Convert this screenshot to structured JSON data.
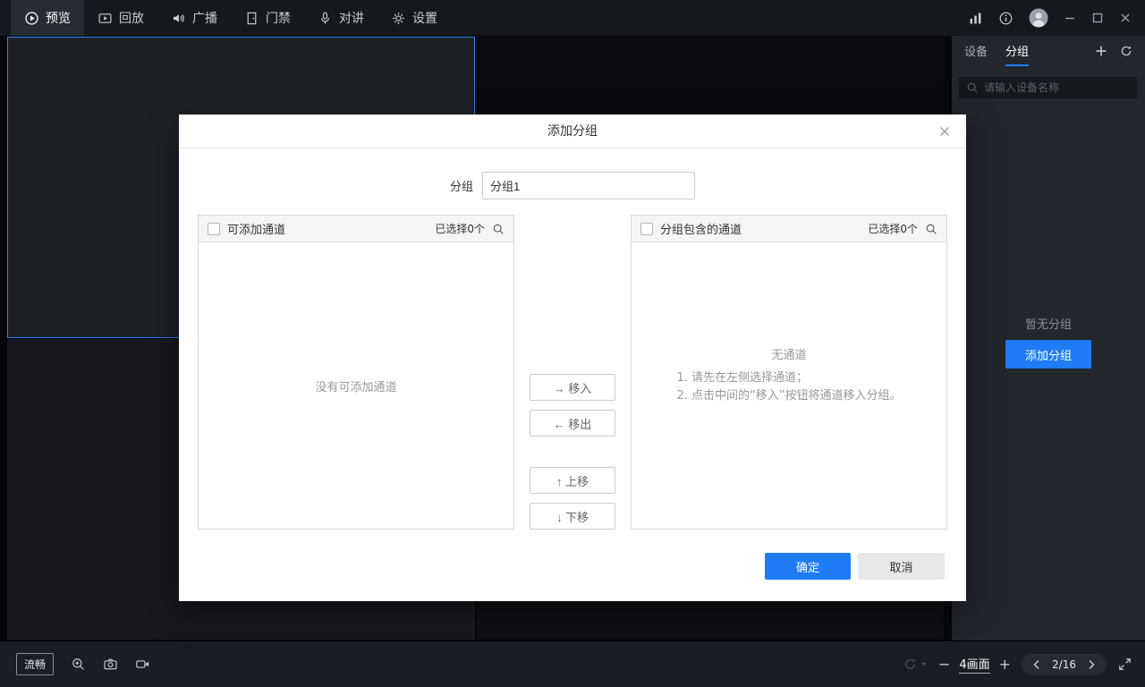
{
  "topbar": {
    "tabs": [
      {
        "label": "预览"
      },
      {
        "label": "回放"
      },
      {
        "label": "广播"
      },
      {
        "label": "门禁"
      },
      {
        "label": "对讲"
      },
      {
        "label": "设置"
      }
    ]
  },
  "sidebar": {
    "tab_device": "设备",
    "tab_group": "分组",
    "search_placeholder": "请输入设备名称",
    "empty_text": "暂无分组",
    "add_group_label": "添加分组"
  },
  "modal": {
    "title": "添加分组",
    "form": {
      "group_label": "分组",
      "group_value": "分组1"
    },
    "left_panel": {
      "title": "可添加通道",
      "selected_count": "已选择0个",
      "empty_text": "没有可添加通道"
    },
    "right_panel": {
      "title": "分组包含的通道",
      "selected_count": "已选择0个",
      "empty_title": "无通道",
      "hint_line1": "1. 请先在左侧选择通道；",
      "hint_line2": "2. 点击中间的“移入”按钮将通道移入分组。"
    },
    "transfer": {
      "move_in": "→ 移入",
      "move_out": "← 移出",
      "move_up": "↑ 上移",
      "move_down": "↓ 下移"
    },
    "footer": {
      "ok": "确定",
      "cancel": "取消"
    }
  },
  "bottombar": {
    "stream_quality": "流畅",
    "minus": "−",
    "screen_layout": "4画面",
    "plus": "+",
    "page_indicator": "2/16"
  },
  "colors": {
    "accent": "#1f7cf6"
  }
}
